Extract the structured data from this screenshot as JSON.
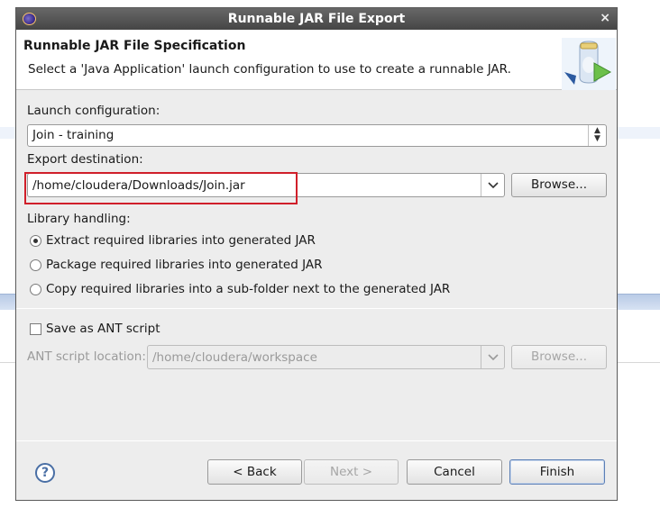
{
  "dialog": {
    "title": "Runnable JAR File Export",
    "close_glyph": "×"
  },
  "header": {
    "title": "Runnable JAR File Specification",
    "description": "Select a 'Java Application' launch configuration to use to create a runnable JAR.",
    "icon": "jar-export-wizard-icon"
  },
  "launch": {
    "label": "Launch configuration:",
    "selected": "Join - training"
  },
  "export": {
    "label": "Export destination:",
    "value": "/home/cloudera/Downloads/Join.jar",
    "browse_label": "Browse..."
  },
  "library": {
    "label": "Library handling:",
    "options": [
      {
        "label": "Extract required libraries into generated JAR",
        "selected": true
      },
      {
        "label": "Package required libraries into generated JAR",
        "selected": false
      },
      {
        "label": "Copy required libraries into a sub-folder next to the generated JAR",
        "selected": false
      }
    ]
  },
  "ant": {
    "checkbox_label": "Save as ANT script",
    "checked": false,
    "location_label": "ANT script location:",
    "location_value": "/home/cloudera/workspace",
    "browse_label": "Browse..."
  },
  "footer": {
    "help_glyph": "?",
    "back_label": "< Back",
    "next_label": "Next >",
    "cancel_label": "Cancel",
    "finish_label": "Finish"
  },
  "colors": {
    "highlight_box": "#d01f2a",
    "titlebar": "#4f4f4f",
    "dialog_bg": "#ededed"
  }
}
